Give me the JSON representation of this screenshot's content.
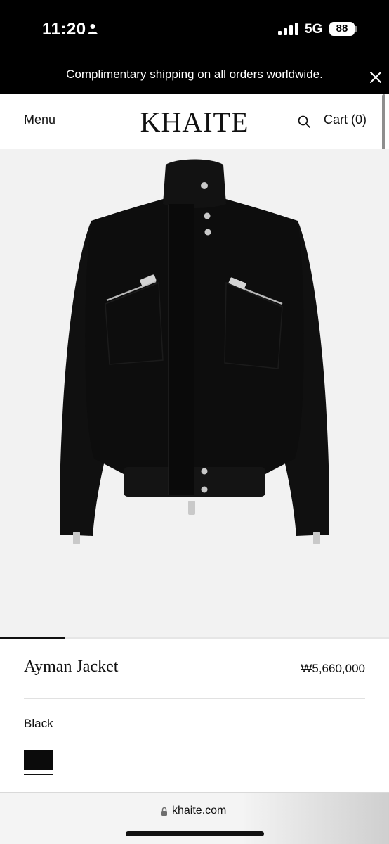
{
  "status_bar": {
    "time": "11:20",
    "network": "5G",
    "battery": "88"
  },
  "promo": {
    "text": "Complimentary shipping on all orders ",
    "link": "worldwide."
  },
  "header": {
    "menu_label": "Menu",
    "logo": "KHAITE",
    "cart_label": "Cart (0)"
  },
  "product": {
    "name": "Ayman Jacket",
    "price": "₩5,660,000",
    "color_label": "Black",
    "swatch_color": "#0b0b0b"
  },
  "browser": {
    "url": "khaite.com"
  },
  "icons": {
    "person": "person-icon",
    "signal": "signal-icon",
    "close": "close-icon",
    "search": "search-icon",
    "lock": "lock-icon"
  }
}
